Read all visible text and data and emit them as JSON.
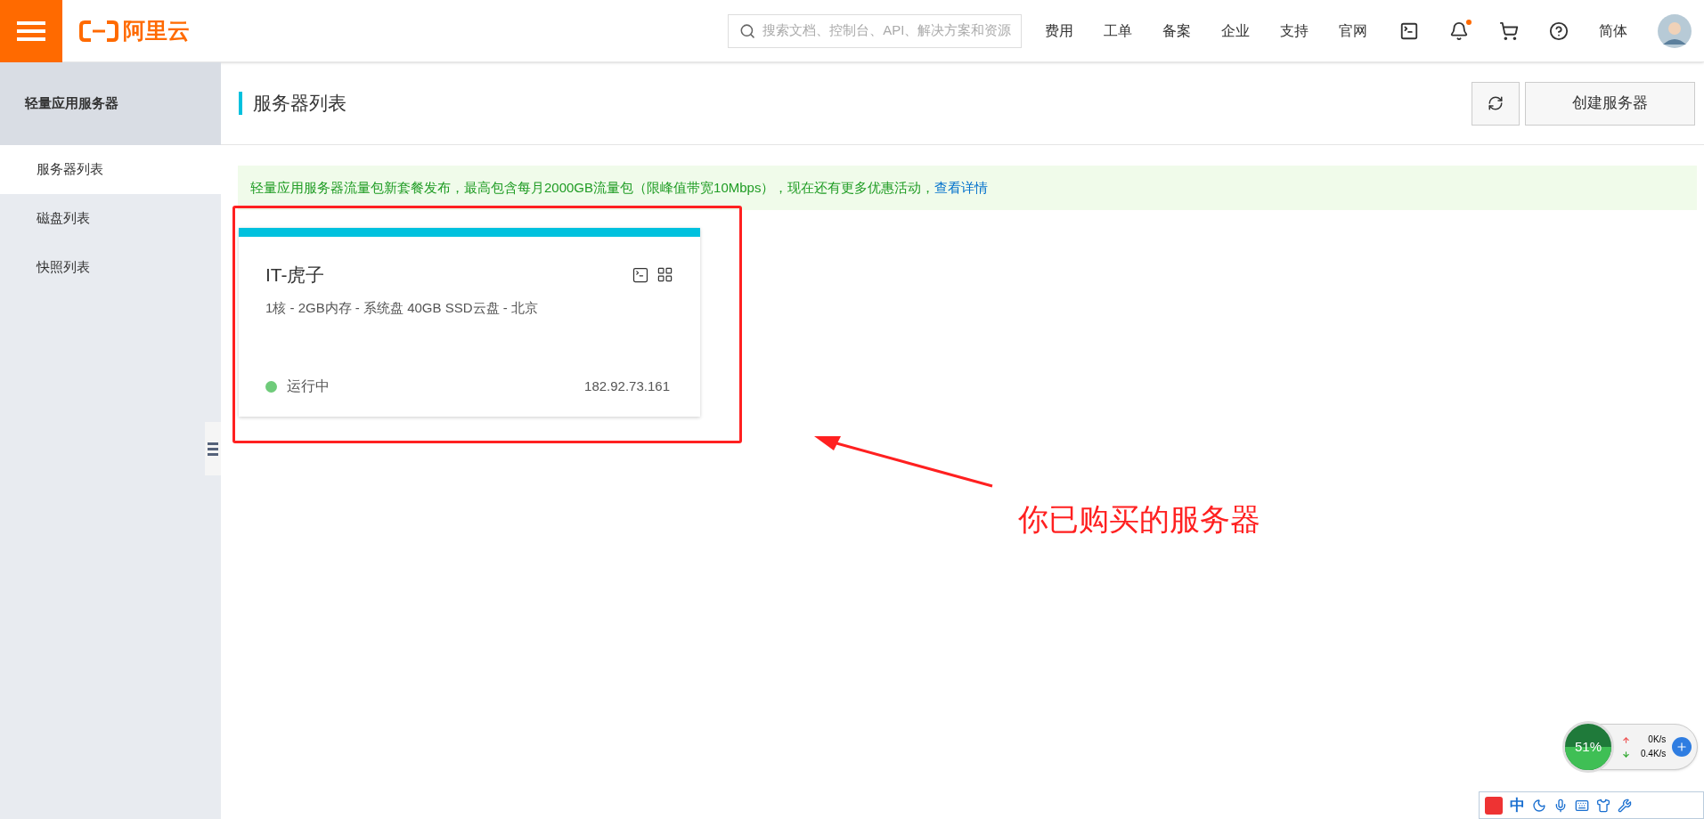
{
  "header": {
    "logo": "阿里云",
    "search": {
      "placeholder": "搜索文档、控制台、API、解决方案和资源"
    },
    "nav": [
      "费用",
      "工单",
      "备案",
      "企业",
      "支持",
      "官网"
    ],
    "bell_unread": true,
    "language": "简体"
  },
  "sidebar": {
    "title": "轻量应用服务器",
    "items": [
      {
        "label": "服务器列表",
        "selected": true
      },
      {
        "label": "磁盘列表",
        "selected": false
      },
      {
        "label": "快照列表",
        "selected": false
      }
    ]
  },
  "page": {
    "title": "服务器列表",
    "create_button": "创建服务器"
  },
  "notice": {
    "text": "轻量应用服务器流量包新套餐发布，最高包含每月2000GB流量包（限峰值带宽10Mbps），现在还有更多优惠活动，",
    "link": "查看详情"
  },
  "servers": [
    {
      "name": "IT-虎子",
      "spec": "1核 - 2GB内存 - 系统盘 40GB SSD云盘 - 北京",
      "status": "运行中",
      "color": "#6fcb7a",
      "ip": "182.92.73.161"
    }
  ],
  "annotation": {
    "text": "你已购买的服务器"
  },
  "speed_widget": {
    "percent": "51%",
    "upload": "0K/s",
    "download": "0.4K/s"
  },
  "ime_toolbar": {
    "mode": "中"
  }
}
